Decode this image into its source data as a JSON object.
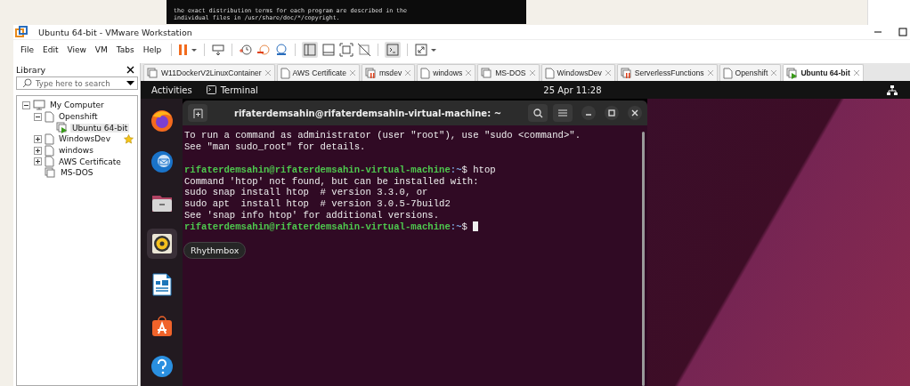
{
  "background_terminal": {
    "lines": [
      "the exact distribution terms for each program are described in the",
      "individual files in /usr/share/doc/*/copyright."
    ]
  },
  "window": {
    "title": "Ubuntu 64-bit - VMware Workstation"
  },
  "menu": [
    "File",
    "Edit",
    "View",
    "VM",
    "Tabs",
    "Help"
  ],
  "library": {
    "title": "Library",
    "search": {
      "placeholder": "Type here to search"
    },
    "tree": [
      {
        "label": "My Computer",
        "kind": "computer",
        "expanded": true,
        "selected": false,
        "favorite": false,
        "children": [
          {
            "label": "Openshift",
            "kind": "folder",
            "expanded": true,
            "selected": false,
            "favorite": false,
            "children": [
              {
                "label": "Ubuntu 64-bit",
                "kind": "running",
                "selected": true,
                "favorite": false
              }
            ]
          },
          {
            "label": "WindowsDev",
            "kind": "folder",
            "expanded": false,
            "selected": false,
            "favorite": true
          },
          {
            "label": "windows",
            "kind": "folder",
            "expanded": false,
            "selected": false,
            "favorite": false
          },
          {
            "label": "AWS Certificate",
            "kind": "folder",
            "expanded": false,
            "selected": false,
            "favorite": false
          },
          {
            "label": "MS-DOS",
            "kind": "group",
            "selected": false,
            "favorite": false
          }
        ]
      }
    ]
  },
  "tabs": [
    {
      "label": "W11DockerV2LinuxContainer",
      "kind": "group",
      "selected": false
    },
    {
      "label": "AWS Certificate",
      "kind": "folder",
      "selected": false
    },
    {
      "label": "msdev",
      "kind": "paused",
      "selected": false
    },
    {
      "label": "windows",
      "kind": "folder",
      "selected": false
    },
    {
      "label": "MS-DOS",
      "kind": "group",
      "selected": false
    },
    {
      "label": "WindowsDev",
      "kind": "folder",
      "selected": false
    },
    {
      "label": "ServerlessFunctions",
      "kind": "paused",
      "selected": false
    },
    {
      "label": "Openshift",
      "kind": "folder",
      "selected": false
    },
    {
      "label": "Ubuntu 64-bit",
      "kind": "running",
      "selected": true
    }
  ],
  "guest": {
    "topbar": {
      "activities": "Activities",
      "app": "Terminal",
      "clock": "25 Apr  11:28"
    },
    "dock": [
      {
        "kind": "browser",
        "highlighted": false
      },
      {
        "kind": "mail",
        "highlighted": false
      },
      {
        "kind": "files",
        "highlighted": false
      },
      {
        "kind": "music",
        "highlighted": true
      },
      {
        "kind": "writer",
        "highlighted": false
      },
      {
        "kind": "store",
        "highlighted": false
      },
      {
        "kind": "help",
        "highlighted": false
      }
    ],
    "tooltip": "Rhythmbox",
    "terminal": {
      "title": "rifaterdemsahin@rifaterdemsahin-virtual-machine: ~",
      "lines": [
        {
          "kind": "output",
          "text": "To run a command as administrator (user \"root\"), use \"sudo <command>\"."
        },
        {
          "kind": "output",
          "text": "See \"man sudo_root\" for details."
        },
        {
          "kind": "blank"
        },
        {
          "kind": "prompt",
          "user": "rifaterdemsahin@rifaterdemsahin-virtual-machine",
          "path": ":~",
          "command": "$ htop",
          "cursor": false
        },
        {
          "kind": "output",
          "text": "Command 'htop' not found, but can be installed with:"
        },
        {
          "kind": "output",
          "text": "sudo snap install htop  # version 3.3.0, or"
        },
        {
          "kind": "output",
          "text": "sudo apt  install htop  # version 3.0.5-7build2"
        },
        {
          "kind": "output",
          "text": "See 'snap info htop' for additional versions."
        },
        {
          "kind": "prompt",
          "user": "rifaterdemsahin@rifaterdemsahin-virtual-machine",
          "path": ":~",
          "command": "$ ",
          "cursor": true
        }
      ]
    }
  }
}
